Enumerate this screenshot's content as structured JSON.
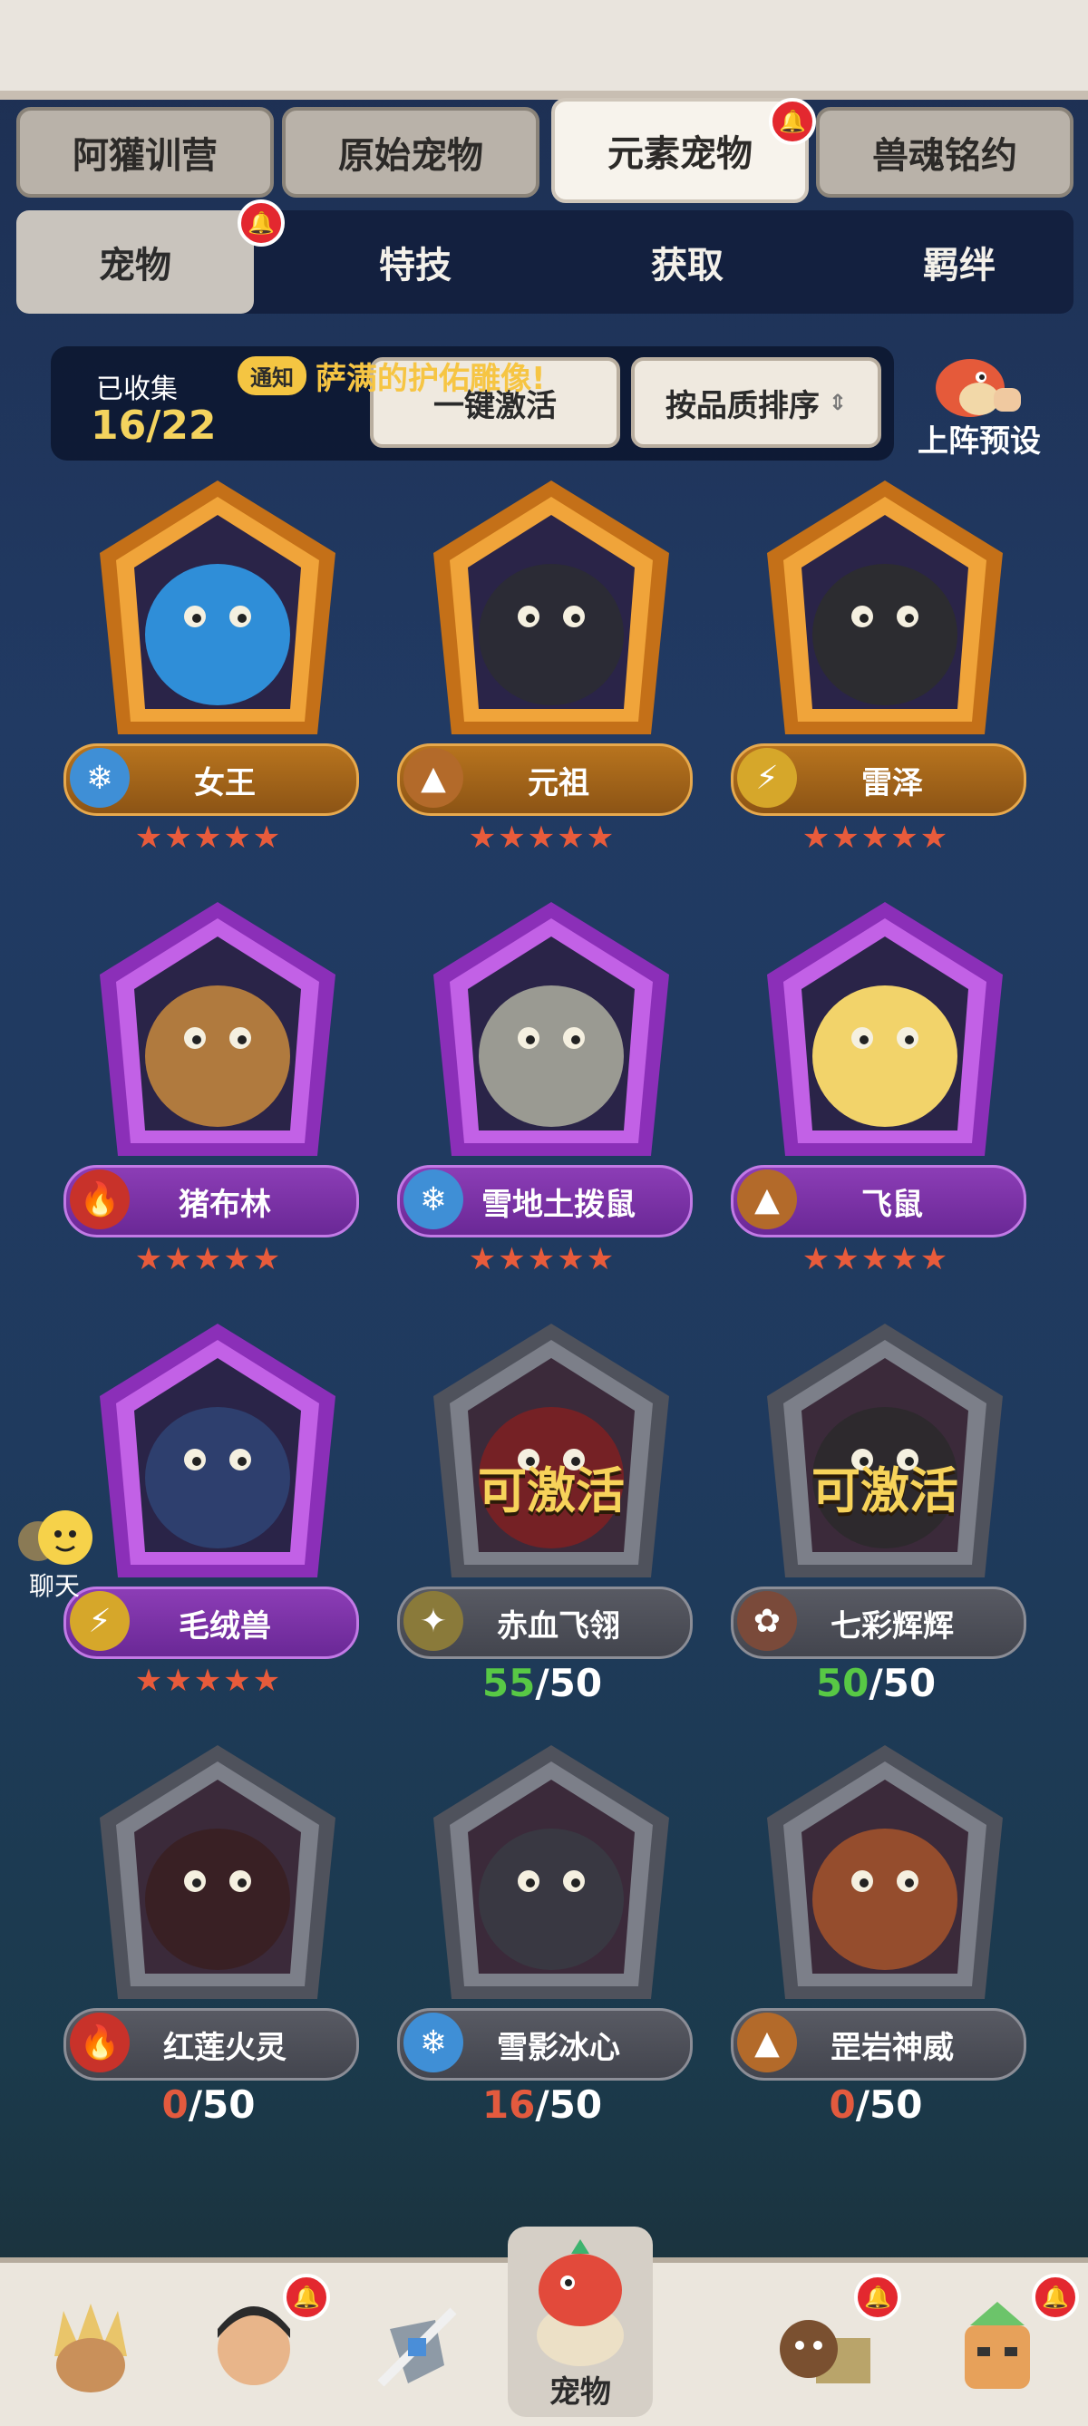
{
  "tabs": [
    {
      "label": "阿獾训营",
      "active": false,
      "badge": false
    },
    {
      "label": "原始宠物",
      "active": false,
      "badge": false
    },
    {
      "label": "元素宠物",
      "active": true,
      "badge": true
    },
    {
      "label": "兽魂铭约",
      "active": false,
      "badge": false
    }
  ],
  "subtabs": [
    {
      "label": "宠物",
      "active": true,
      "badge": true
    },
    {
      "label": "特技",
      "active": false
    },
    {
      "label": "获取",
      "active": false
    },
    {
      "label": "羁绊",
      "active": false
    }
  ],
  "collection": {
    "label": "已收集",
    "value": "16/22"
  },
  "notice": {
    "tag": "通知",
    "text": "萨满的护佑雕像!"
  },
  "buttons": {
    "activate_all": "一键激活",
    "sort": "按品质排序",
    "preset": "上阵预设"
  },
  "pets": [
    {
      "name": "女王",
      "element": "ice",
      "quality": "gold",
      "stars": "★★★★★"
    },
    {
      "name": "元祖",
      "element": "earth",
      "quality": "gold",
      "stars": "★★★★★"
    },
    {
      "name": "雷泽",
      "element": "thunder",
      "quality": "gold",
      "stars": "★★★★★"
    },
    {
      "name": "猪布林",
      "element": "fire",
      "quality": "purple",
      "stars": "★★★★★"
    },
    {
      "name": "雪地土拨鼠",
      "element": "ice",
      "quality": "purple",
      "stars": "★★★★★"
    },
    {
      "name": "飞鼠",
      "element": "earth",
      "quality": "purple",
      "stars": "★★★★★"
    },
    {
      "name": "毛绒兽",
      "element": "thunder",
      "quality": "purple",
      "stars": "★★★★★"
    },
    {
      "name": "赤血飞翎",
      "element": "light",
      "quality": "grey",
      "progress": {
        "cur": "55",
        "max": "50",
        "color": "#58c845"
      },
      "overlay": "可激活"
    },
    {
      "name": "七彩辉辉",
      "element": "paw",
      "quality": "grey",
      "progress": {
        "cur": "50",
        "max": "50",
        "color": "#58c845"
      },
      "overlay": "可激活"
    },
    {
      "name": "红莲火灵",
      "element": "fire",
      "quality": "grey",
      "progress": {
        "cur": "0",
        "max": "50",
        "color": "#e35a3e"
      }
    },
    {
      "name": "雪影冰心",
      "element": "ice",
      "quality": "grey",
      "progress": {
        "cur": "16",
        "max": "50",
        "color": "#e35a3e"
      }
    },
    {
      "name": "罡岩神威",
      "element": "earth",
      "quality": "grey",
      "progress": {
        "cur": "0",
        "max": "50",
        "color": "#e35a3e"
      }
    }
  ],
  "chat": {
    "label": "聊天"
  },
  "bottom_nav": {
    "active_label": "宠物"
  },
  "colors": {
    "gold": "#b8741e",
    "purple": "#8c3db6",
    "grey": "#585a63",
    "star": "#e85b3b",
    "accent": "#f4d35e"
  }
}
